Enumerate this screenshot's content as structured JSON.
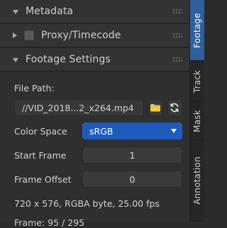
{
  "sidebar_panel": {
    "sections": [
      {
        "label": "Metadata",
        "state": "collapsed"
      },
      {
        "label": "Proxy/Timecode",
        "state": "collapsed"
      },
      {
        "label": "Footage Settings",
        "state": "expanded"
      }
    ]
  },
  "footage_settings": {
    "file_path_label": "File Path:",
    "file_path_value": "//VID_2018...2_x264.mp4",
    "color_space_label": "Color Space",
    "color_space_value": "sRGB",
    "start_frame_label": "Start Frame",
    "start_frame_value": "1",
    "frame_offset_label": "Frame Offset",
    "frame_offset_value": "0",
    "info_line": "720 x 576, RGBA byte, 25.00 fps",
    "frame_line": "Frame: 95 / 295"
  },
  "right_tabs": [
    {
      "label": "Footage",
      "active": true
    },
    {
      "label": "Track",
      "active": false
    },
    {
      "label": "Mask",
      "active": false
    },
    {
      "label": "Annotation",
      "active": false
    }
  ],
  "icons": {
    "collapse_triangle": "triangle-icon",
    "proxy_checkbox": "checkbox-icon",
    "folder": "folder-icon",
    "reload": "reload-icon",
    "grip": "grip-icon",
    "dropdown": "chevron-down-icon"
  },
  "colors": {
    "accent": "#1f5bbd",
    "active_tab": "#2f5f9c",
    "folder_yellow": "#f2c94c"
  }
}
